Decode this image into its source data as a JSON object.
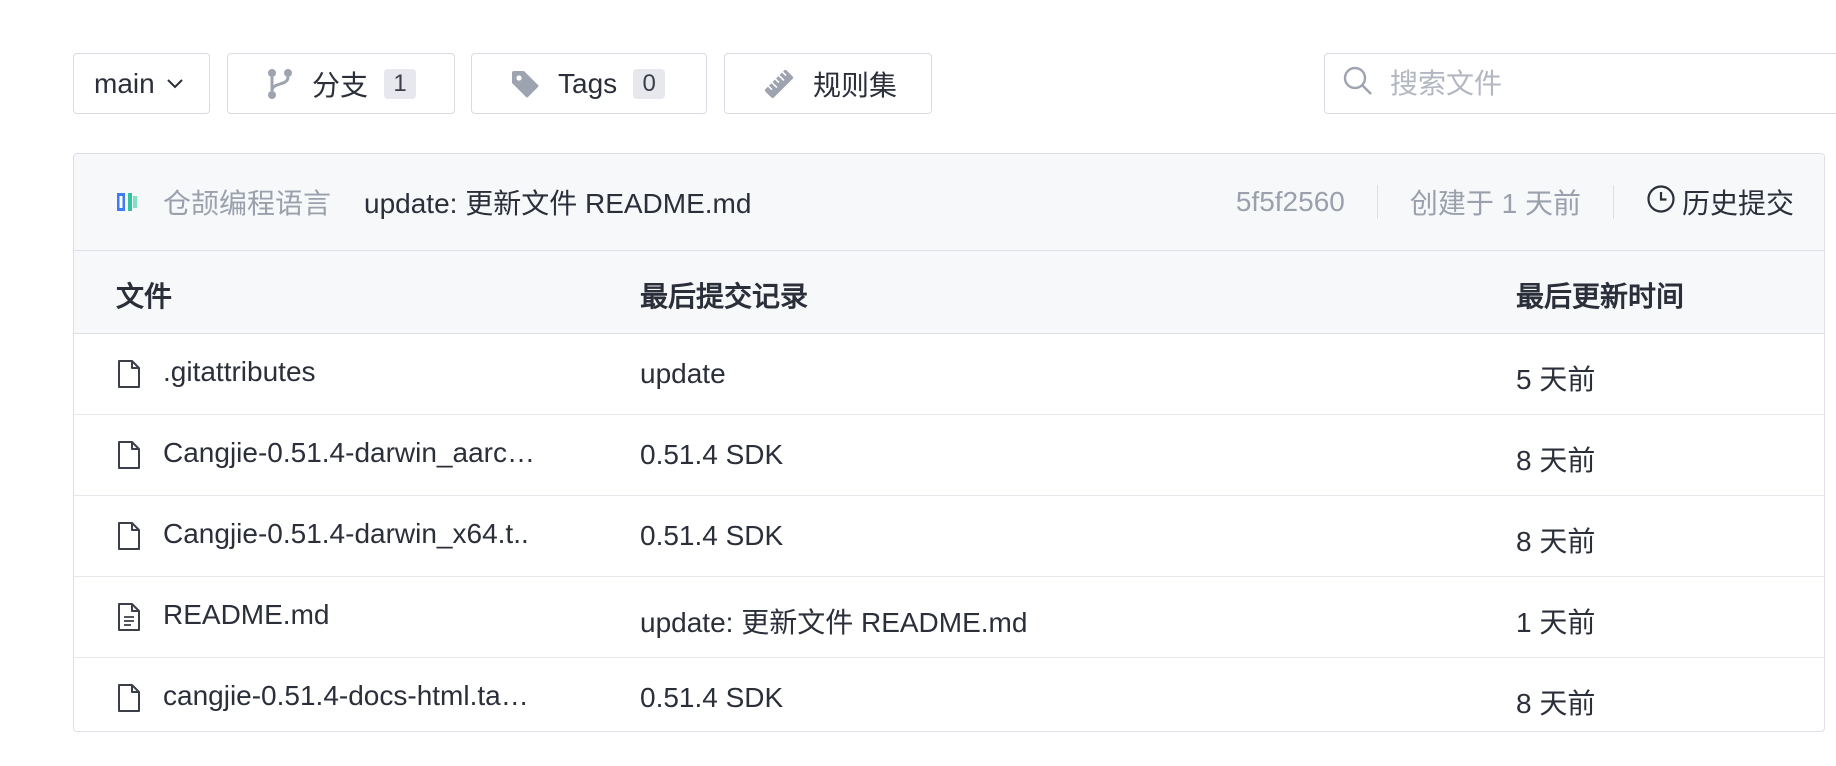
{
  "toolbar": {
    "branch": {
      "value": "main",
      "icon": "chevron-down-icon"
    },
    "branches": {
      "label": "分支",
      "count": "1",
      "icon": "branch-icon"
    },
    "tags": {
      "label": "Tags",
      "count": "0",
      "icon": "tag-icon"
    },
    "rules": {
      "label": "规则集",
      "icon": "ruler-icon"
    },
    "search": {
      "placeholder": "搜索文件",
      "icon": "search-icon"
    }
  },
  "commit": {
    "author": "仓颉编程语言",
    "message": "update: 更新文件 README.md",
    "hash": "5f5f2560",
    "created": "创建于 1 天前",
    "history_label": "历史提交",
    "history_icon": "clock-icon"
  },
  "table": {
    "headers": {
      "file": "文件",
      "last_commit": "最后提交记录",
      "last_updated": "最后更新时间"
    },
    "rows": [
      {
        "name": ".gitattributes",
        "commit": "update",
        "updated": "5 天前",
        "icon": "file-icon"
      },
      {
        "name": "Cangjie-0.51.4-darwin_aarc…",
        "commit": "0.51.4 SDK",
        "updated": "8 天前",
        "icon": "file-icon"
      },
      {
        "name": "Cangjie-0.51.4-darwin_x64.t..",
        "commit": "0.51.4 SDK",
        "updated": "8 天前",
        "icon": "file-icon"
      },
      {
        "name": "README.md",
        "commit": "update: 更新文件 README.md",
        "updated": "1 天前",
        "icon": "file-text-icon"
      },
      {
        "name": "cangjie-0.51.4-docs-html.ta…",
        "commit": "0.51.4 SDK",
        "updated": "8 天前",
        "icon": "file-icon"
      }
    ]
  },
  "colors": {
    "border": "#d8dbe2",
    "muted_text": "#9aa0ac",
    "header_bg": "#f7f8fa",
    "icon_gray": "#9ea3b0",
    "badge_bg": "#e6e8ee"
  }
}
